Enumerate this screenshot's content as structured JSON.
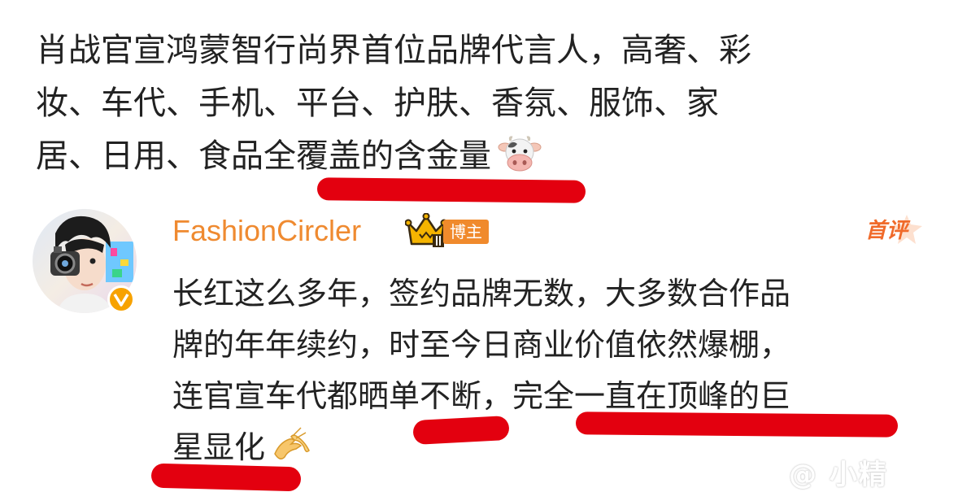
{
  "post": {
    "lines": [
      "肖战官宣鸿蒙智行尚界首位品牌代言人，高奢、彩",
      "妆、车代、手机、平台、护肤、香氛、服饰、家",
      "居、日用、食品全覆盖的含金量"
    ],
    "emoji": "cow-face-icon"
  },
  "comment": {
    "username": "FashionCircler",
    "badge": "博主",
    "first_comment": "首评",
    "lines": [
      "长红这么多年，签约品牌无数，大多数合作品",
      "牌的年年续约，时至今日商业价值依然爆棚，",
      "连官宣车代都晒单不断，完全一直在顶峰的巨",
      "星显化"
    ],
    "emoji": "pinching-hands-icon",
    "crown": "crown-level-2-icon",
    "verified": "verified-v-icon"
  },
  "colors": {
    "username": "#ef8a30",
    "badge_bg": "#f08a2c",
    "underline": "#e3000f",
    "first_comment": "#f06a2a"
  },
  "watermark": "@ 小精"
}
